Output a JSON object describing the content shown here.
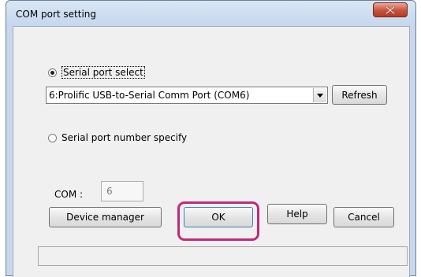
{
  "window": {
    "title": "COM port setting",
    "close_icon": "close-icon"
  },
  "serial_select": {
    "label": "Serial port select",
    "selected": true
  },
  "port_combo": {
    "value": "6:Prolific USB-to-Serial Comm Port (COM6)",
    "arrow_icon": "dropdown-arrow-icon"
  },
  "refresh_label": "Refresh",
  "number_specify": {
    "label": "Serial port number specify",
    "selected": false
  },
  "com": {
    "label": "COM :",
    "value": "6"
  },
  "buttons": {
    "device_manager": "Device manager",
    "ok": "OK",
    "help": "Help",
    "cancel": "Cancel"
  },
  "status_text": "",
  "colors": {
    "highlight": "#c0297a",
    "close_button": "#c9513a"
  }
}
